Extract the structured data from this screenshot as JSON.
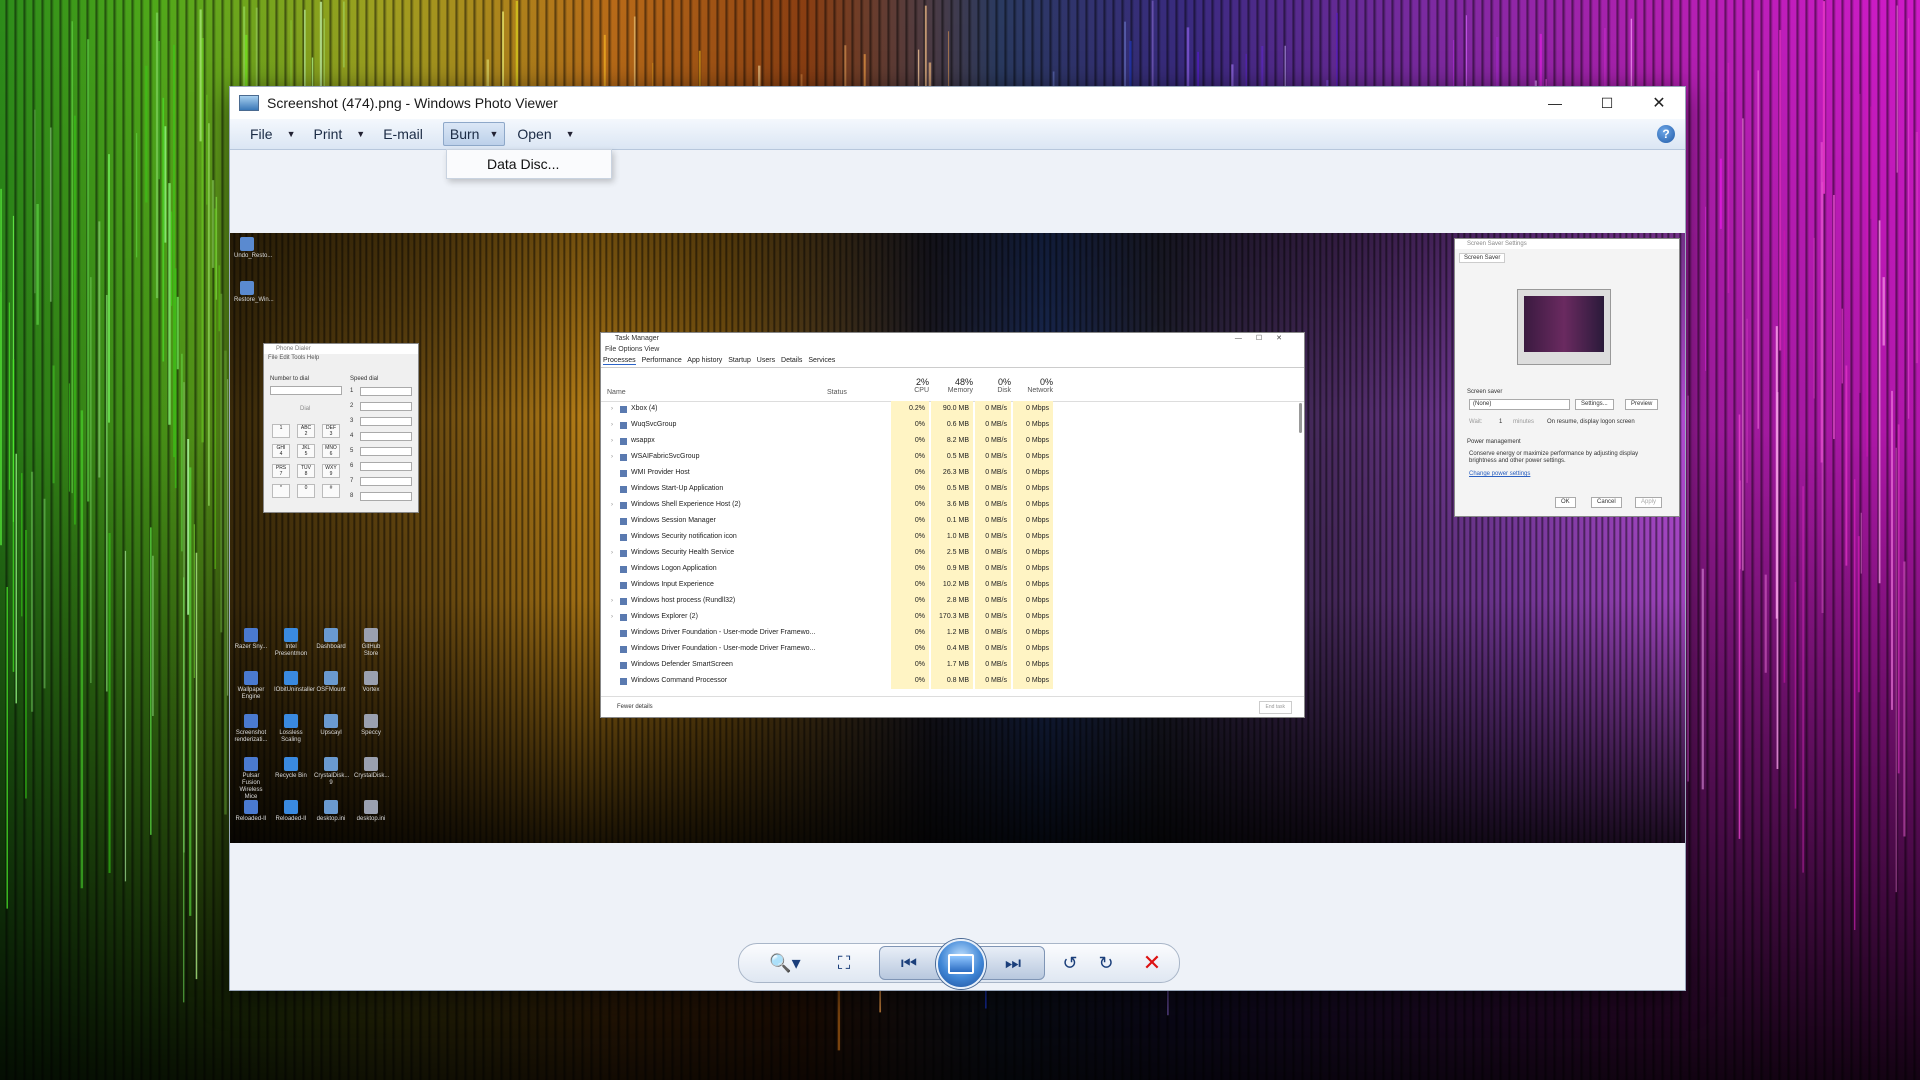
{
  "window": {
    "title": "Screenshot (474).png - Windows Photo Viewer",
    "minimize": "—",
    "maximize": "☐",
    "close": "✕"
  },
  "menu": {
    "file": "File",
    "print": "Print",
    "email": "E-mail",
    "burn": "Burn",
    "open": "Open",
    "help": "?"
  },
  "burn_dropdown": {
    "item": "Data Disc..."
  },
  "screenshot": {
    "desktop_icons": [
      "Undo_Resto...",
      "Restore_Win..."
    ],
    "dialer": {
      "title": "Phone Dialer",
      "menu": "File   Edit   Tools   Help",
      "number_label": "Number to dial",
      "speed_label": "Speed dial",
      "dial": "Dial",
      "keys": [
        "1",
        "ABC\n2",
        "DEF\n3",
        "GHI\n4",
        "JKL\n5",
        "MNO\n6",
        "PRS\n7",
        "TUV\n8",
        "WXY\n9",
        "*",
        "0",
        "#"
      ],
      "speed_numbers": [
        "1",
        "2",
        "3",
        "4",
        "5",
        "6",
        "7",
        "8"
      ]
    },
    "taskmgr": {
      "title": "Task Manager",
      "menu": "File   Options   View",
      "tabs": [
        "Processes",
        "Performance",
        "App history",
        "Startup",
        "Users",
        "Details",
        "Services"
      ],
      "headers": {
        "name": "Name",
        "status": "Status",
        "cpu": "CPU",
        "cpu_pct": "2%",
        "memory": "Memory",
        "memory_pct": "48%",
        "disk": "Disk",
        "disk_pct": "0%",
        "network": "Network",
        "network_pct": "0%"
      },
      "rows": [
        {
          "name": "Xbox (4)",
          "cpu": "0.2%",
          "mem": "90.0 MB",
          "disk": "0 MB/s",
          "net": "0 Mbps"
        },
        {
          "name": "WuqSvcGroup",
          "cpu": "0%",
          "mem": "0.6 MB",
          "disk": "0 MB/s",
          "net": "0 Mbps"
        },
        {
          "name": "wsappx",
          "cpu": "0%",
          "mem": "8.2 MB",
          "disk": "0 MB/s",
          "net": "0 Mbps"
        },
        {
          "name": "WSAIFabricSvcGroup",
          "cpu": "0%",
          "mem": "0.5 MB",
          "disk": "0 MB/s",
          "net": "0 Mbps"
        },
        {
          "name": "WMI Provider Host",
          "cpu": "0%",
          "mem": "26.3 MB",
          "disk": "0 MB/s",
          "net": "0 Mbps"
        },
        {
          "name": "Windows Start-Up Application",
          "cpu": "0%",
          "mem": "0.5 MB",
          "disk": "0 MB/s",
          "net": "0 Mbps"
        },
        {
          "name": "Windows Shell Experience Host (2)",
          "cpu": "0%",
          "mem": "3.6 MB",
          "disk": "0 MB/s",
          "net": "0 Mbps"
        },
        {
          "name": "Windows Session Manager",
          "cpu": "0%",
          "mem": "0.1 MB",
          "disk": "0 MB/s",
          "net": "0 Mbps"
        },
        {
          "name": "Windows Security notification icon",
          "cpu": "0%",
          "mem": "1.0 MB",
          "disk": "0 MB/s",
          "net": "0 Mbps"
        },
        {
          "name": "Windows Security Health Service",
          "cpu": "0%",
          "mem": "2.5 MB",
          "disk": "0 MB/s",
          "net": "0 Mbps"
        },
        {
          "name": "Windows Logon Application",
          "cpu": "0%",
          "mem": "0.9 MB",
          "disk": "0 MB/s",
          "net": "0 Mbps"
        },
        {
          "name": "Windows Input Experience",
          "cpu": "0%",
          "mem": "10.2 MB",
          "disk": "0 MB/s",
          "net": "0 Mbps"
        },
        {
          "name": "Windows host process (Rundll32)",
          "cpu": "0%",
          "mem": "2.8 MB",
          "disk": "0 MB/s",
          "net": "0 Mbps"
        },
        {
          "name": "Windows Explorer (2)",
          "cpu": "0%",
          "mem": "170.3 MB",
          "disk": "0 MB/s",
          "net": "0 Mbps"
        },
        {
          "name": "Windows Driver Foundation - User-mode Driver Framewo...",
          "cpu": "0%",
          "mem": "1.2 MB",
          "disk": "0 MB/s",
          "net": "0 Mbps"
        },
        {
          "name": "Windows Driver Foundation - User-mode Driver Framewo...",
          "cpu": "0%",
          "mem": "0.4 MB",
          "disk": "0 MB/s",
          "net": "0 Mbps"
        },
        {
          "name": "Windows Defender SmartScreen",
          "cpu": "0%",
          "mem": "1.7 MB",
          "disk": "0 MB/s",
          "net": "0 Mbps"
        },
        {
          "name": "Windows Command Processor",
          "cpu": "0%",
          "mem": "0.8 MB",
          "disk": "0 MB/s",
          "net": "0 Mbps"
        }
      ],
      "fewer_details": "Fewer details",
      "end_task": "End task"
    },
    "screensaver": {
      "title": "Screen Saver Settings",
      "tab": "Screen Saver",
      "section": "Screen saver",
      "selected": "(None)",
      "settings_btn": "Settings...",
      "preview_btn": "Preview",
      "wait": "Wait:",
      "wait_value": "1",
      "minutes": "minutes",
      "resume": "On resume, display logon screen",
      "power_title": "Power management",
      "power_text": "Conserve energy or maximize performance by adjusting display brightness and other power settings.",
      "power_link": "Change power settings",
      "ok": "OK",
      "cancel": "Cancel",
      "apply": "Apply"
    },
    "bottom_icons": [
      "Razer Sny...",
      "Intel Presentmon",
      "Dashboard",
      "GitHub Store",
      "Wallpaper Engine",
      "IObitUninstaller",
      "OSFMount",
      "Vortex",
      "Screenshot renderizati...",
      "Lossless Scaling",
      "Upscayl",
      "Speccy",
      "Pulsar Fusion Wireless Mice",
      "Recycle Bin",
      "CrystalDisk... 9",
      "CrystalDisk...",
      "Reloaded-II",
      "Reloaded-II",
      "desktop.ini",
      "desktop.ini"
    ]
  },
  "toolbar": {
    "zoom": "🔍▾",
    "actual_size": "⛶",
    "previous": "⏮",
    "next": "⏭",
    "rotate_ccw": "↺",
    "rotate_cw": "↻",
    "delete": "✕"
  },
  "colors": {
    "menubar": "#dbe6f4",
    "accent": "#2b63c8",
    "delete": "#dd1111",
    "cpu_highlight": "#fff4c4"
  }
}
